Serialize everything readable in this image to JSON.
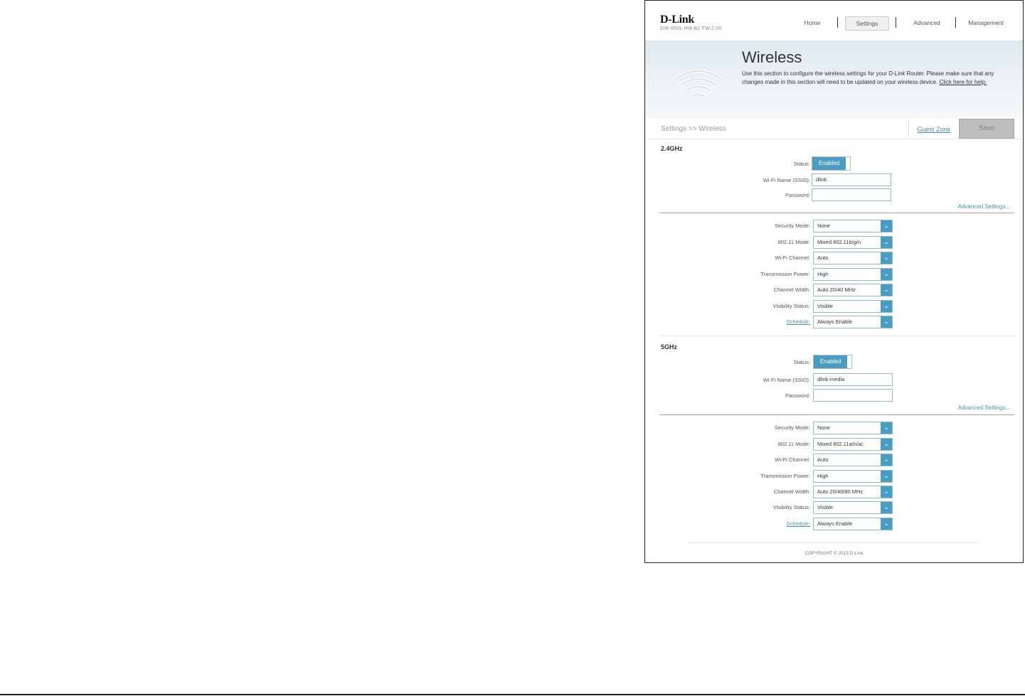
{
  "header": {
    "logo": "D-Link",
    "model": "DIR-850L  HW:B1  FW:2.00",
    "nav": [
      {
        "label": "Home"
      },
      {
        "label": "Settings"
      },
      {
        "label": "Advanced"
      },
      {
        "label": "Management"
      }
    ]
  },
  "banner": {
    "title": "Wireless",
    "description": "Use this section to configure the wireless settings for your D-Link Router. Please make sure that any changes made in this section will need to be updated on your wireless device. ",
    "help_link": "Click here for help."
  },
  "breadcrumb": {
    "text": "Settings >> Wireless",
    "guest_zone": "Guest Zone",
    "save": "Save"
  },
  "band24": {
    "title": "2.4GHz",
    "status_label": "Status:",
    "status_value": "Enabled",
    "ssid_label": "Wi-Fi Name (SSID):",
    "ssid_value": "dlink",
    "password_label": "Password:",
    "password_value": "",
    "advanced": "Advanced Settings...",
    "fields": [
      {
        "label": "Security Mode:",
        "value": "None"
      },
      {
        "label": "802.11 Mode:",
        "value": "Mixed 802.11b/g/n"
      },
      {
        "label": "Wi-Fi Channel:",
        "value": "Auto"
      },
      {
        "label": "Transmission Power:",
        "value": "High"
      },
      {
        "label": "Channel Width:",
        "value": "Auto 20/40 MHz"
      },
      {
        "label": "Visibility Status:",
        "value": "Visible"
      },
      {
        "label": "Schedule:",
        "value": "Always Enable"
      }
    ]
  },
  "band5": {
    "title": "5GHz",
    "status_label": "Status:",
    "status_value": "Enabled",
    "ssid_label": "Wi-Fi Name (SSID):",
    "ssid_value": "dlink-media",
    "password_label": "Password:",
    "password_value": "",
    "advanced": "Advanced Settings...",
    "fields": [
      {
        "label": "Security Mode:",
        "value": "None"
      },
      {
        "label": "802.11 Mode:",
        "value": "Mixed 802.11a/n/ac"
      },
      {
        "label": "Wi-Fi Channel:",
        "value": "Auto"
      },
      {
        "label": "Transmission Power:",
        "value": "High"
      },
      {
        "label": "Channel Width:",
        "value": "Auto 20/40/80 MHz"
      },
      {
        "label": "Visibility Status:",
        "value": "Visible"
      },
      {
        "label": "Schedule:",
        "value": "Always Enable"
      }
    ]
  },
  "footer": {
    "copyright": "COPYRIGHT © 2013 D-Link"
  },
  "colors": {
    "accent": "#4a9cc0",
    "divider": "#c98f8f"
  }
}
